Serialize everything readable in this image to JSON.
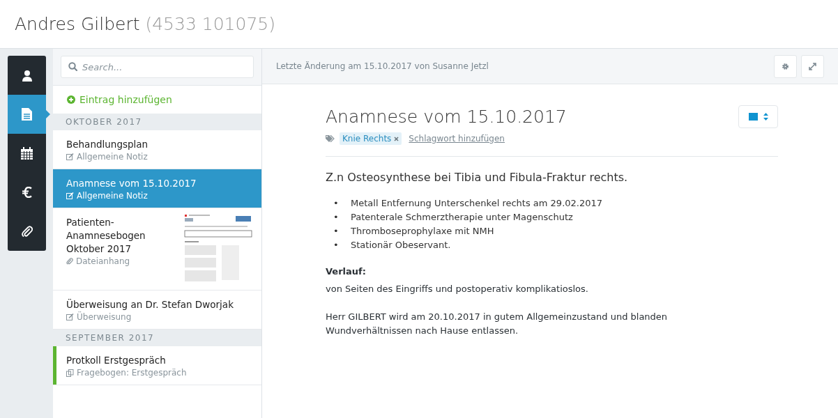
{
  "patient": {
    "name": "Andres Gilbert",
    "number": "(4533 101075)"
  },
  "nav": [
    {
      "selected": false
    },
    {
      "selected": true
    },
    {
      "selected": false
    },
    {
      "selected": false
    },
    {
      "selected": false
    }
  ],
  "search": {
    "placeholder": "Search..."
  },
  "add_entry": "Eintrag hinzufügen",
  "entries": [
    {
      "kind": "group",
      "label": "OKTOBER 2017"
    },
    {
      "kind": "note",
      "title": "Behandlungsplan",
      "type": "Allgemeine Notiz",
      "selected": false
    },
    {
      "kind": "note",
      "title": "Anamnese vom 15.10.2017",
      "type": "Allgemeine Notiz",
      "selected": true
    },
    {
      "kind": "attachment",
      "title": "Patienten-\nAnamnesebogen\nOktober 2017",
      "type": "Dateianhang",
      "selected": false
    },
    {
      "kind": "note",
      "title": "Überweisung an Dr. Stefan Dworjak",
      "type": "Überweisung",
      "selected": false
    },
    {
      "kind": "group",
      "label": "SEPTEMBER 2017"
    },
    {
      "kind": "questionnaire",
      "title": "Protkoll Erstgespräch",
      "type": "Fragebogen: Erstgespräch",
      "selected": false,
      "color": "#5cb531"
    }
  ],
  "toolbar": {
    "last_change": "Letzte Änderung am 15.10.2017 von Susanne Jetzl"
  },
  "document": {
    "title": "Anamnese vom 15.10.2017",
    "tags": [
      "Knie Rechts"
    ],
    "add_tag": "Schlagwort hinzufügen",
    "color": "#0f93d0",
    "heading": "Z.n Osteosynthese bei Tibia und Fibula-Fraktur rechts.",
    "bullet": "•",
    "bullets": [
      "Metall Entfernung Unterschenkel rechts am 29.02.2017",
      "Patenterale Schmerztherapie unter Magenschutz",
      "Thromboseprophylaxe mit NMH",
      "Stationär Obeservant."
    ],
    "section_label": "Verlauf:",
    "paragraphs": [
      "von Seiten des Eingriffs und postoperativ komplikatioslos.",
      "Herr GILBERT wird am 20.10.2017 in gutem Allgemeinzustand und blanden\nWundverhältnissen nach Hause entlassen."
    ]
  }
}
